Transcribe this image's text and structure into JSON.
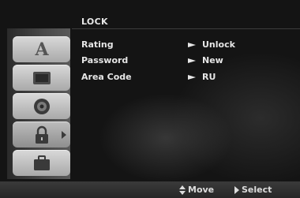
{
  "menu": {
    "title": "LOCK",
    "settings": [
      {
        "label": "Rating",
        "value": "Unlock"
      },
      {
        "label": "Password",
        "value": "New"
      },
      {
        "label": "Area Code",
        "value": "RU"
      }
    ]
  },
  "sidebar": {
    "items": [
      {
        "icon": "language-icon",
        "glyph": "A"
      },
      {
        "icon": "display-icon"
      },
      {
        "icon": "audio-icon"
      },
      {
        "icon": "lock-icon",
        "selected": true
      },
      {
        "icon": "others-icon"
      }
    ]
  },
  "footer": {
    "move_label": "Move",
    "select_label": "Select"
  },
  "colors": {
    "text": "#e6e6e6",
    "tab_light": "#d9d9d9",
    "tab_dark": "#a9a9a9",
    "background": "#141414"
  }
}
